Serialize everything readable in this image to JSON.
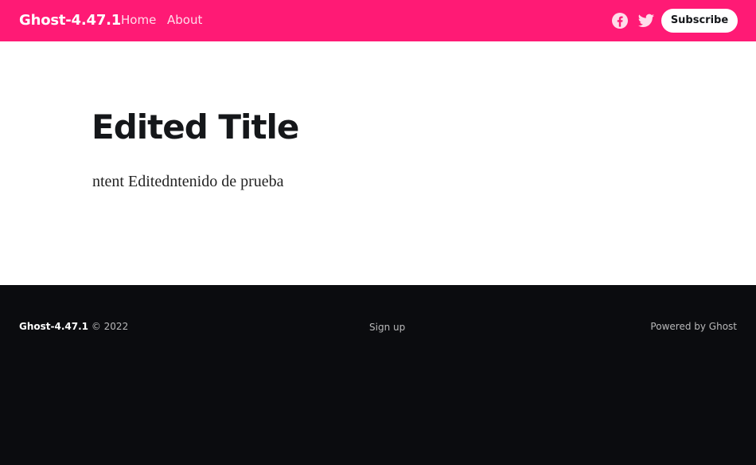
{
  "header": {
    "brand": "Ghost-4.47.1",
    "nav": [
      "Home",
      "About"
    ],
    "social": [
      "facebook-icon",
      "twitter-icon"
    ],
    "subscribe_label": "Subscribe",
    "accent_color": "#ff1a75"
  },
  "post": {
    "title": "Edited Title",
    "content": "ntent Editedntenido de prueba"
  },
  "footer": {
    "brand": "Ghost-4.47.1",
    "copyright": "© 2022",
    "signup_label": "Sign up",
    "powered_label": "Powered by Ghost",
    "background_color": "#0b0c0f"
  }
}
